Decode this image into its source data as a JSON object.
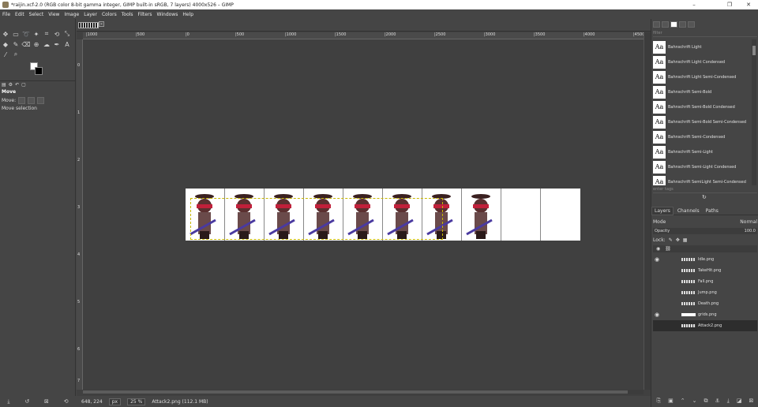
{
  "window": {
    "title": "*raijin.xcf-2.0 (RGB color 8-bit gamma integer, GIMP built-in sRGB, 7 layers) 4000x526 – GIMP",
    "minimize": "–",
    "maximize": "❐",
    "close": "✕"
  },
  "menu": [
    "File",
    "Edit",
    "Select",
    "View",
    "Image",
    "Layer",
    "Colors",
    "Tools",
    "Filters",
    "Windows",
    "Help"
  ],
  "tool_options": {
    "title": "Move",
    "move_label": "Move:",
    "description": "Move selection"
  },
  "ruler": {
    "h_ticks": [
      "|1000",
      "|500",
      "|0",
      "|500",
      "|1000",
      "|1500",
      "|2000",
      "|2500",
      "|3000",
      "|3500",
      "|4000",
      "|4500"
    ],
    "v_ticks": [
      "0",
      "1",
      "2",
      "3",
      "4",
      "5",
      "6",
      "7"
    ]
  },
  "status": {
    "coords": "648, 224",
    "unit": "px",
    "zoom": "25 %",
    "layer_info": "Attack2.png (112.1 MB)"
  },
  "fonts": {
    "filter_placeholder": "filter",
    "items": [
      "Bahnschrift Light",
      "Bahnschrift Light Condensed",
      "Bahnschrift Light Semi-Condensed",
      "Bahnschrift Semi-Bold",
      "Bahnschrift Semi-Bold Condensed",
      "Bahnschrift Semi-Bold Semi-Condensed",
      "Bahnschrift Semi-Condensed",
      "Bahnschrift Semi-Light",
      "Bahnschrift Semi-Light Condensed",
      "Bahnschrift SemiLight Semi-Condensed"
    ],
    "glyph": "Aa",
    "tags_placeholder": "enter tags"
  },
  "layers_panel": {
    "tabs": [
      "Layers",
      "Channels",
      "Paths"
    ],
    "mode_label": "Mode",
    "mode_value": "Normal",
    "opacity_label": "Opacity",
    "opacity_value": "100.0",
    "lock_label": "Lock:",
    "layers": [
      {
        "name": "Idle.png",
        "visible": true,
        "thumb": "strip"
      },
      {
        "name": "TakeHit.png",
        "visible": false,
        "thumb": "strip"
      },
      {
        "name": "Fall.png",
        "visible": false,
        "thumb": "strip"
      },
      {
        "name": "Jump.png",
        "visible": false,
        "thumb": "strip"
      },
      {
        "name": "Death.png",
        "visible": false,
        "thumb": "strip"
      },
      {
        "name": "grids.png",
        "visible": true,
        "thumb": "white"
      },
      {
        "name": "Attack2.png",
        "visible": false,
        "thumb": "strip",
        "selected": true
      }
    ]
  },
  "colors": {
    "accent": "#c8b800",
    "fg": "#ffffff",
    "bg": "#000000"
  }
}
